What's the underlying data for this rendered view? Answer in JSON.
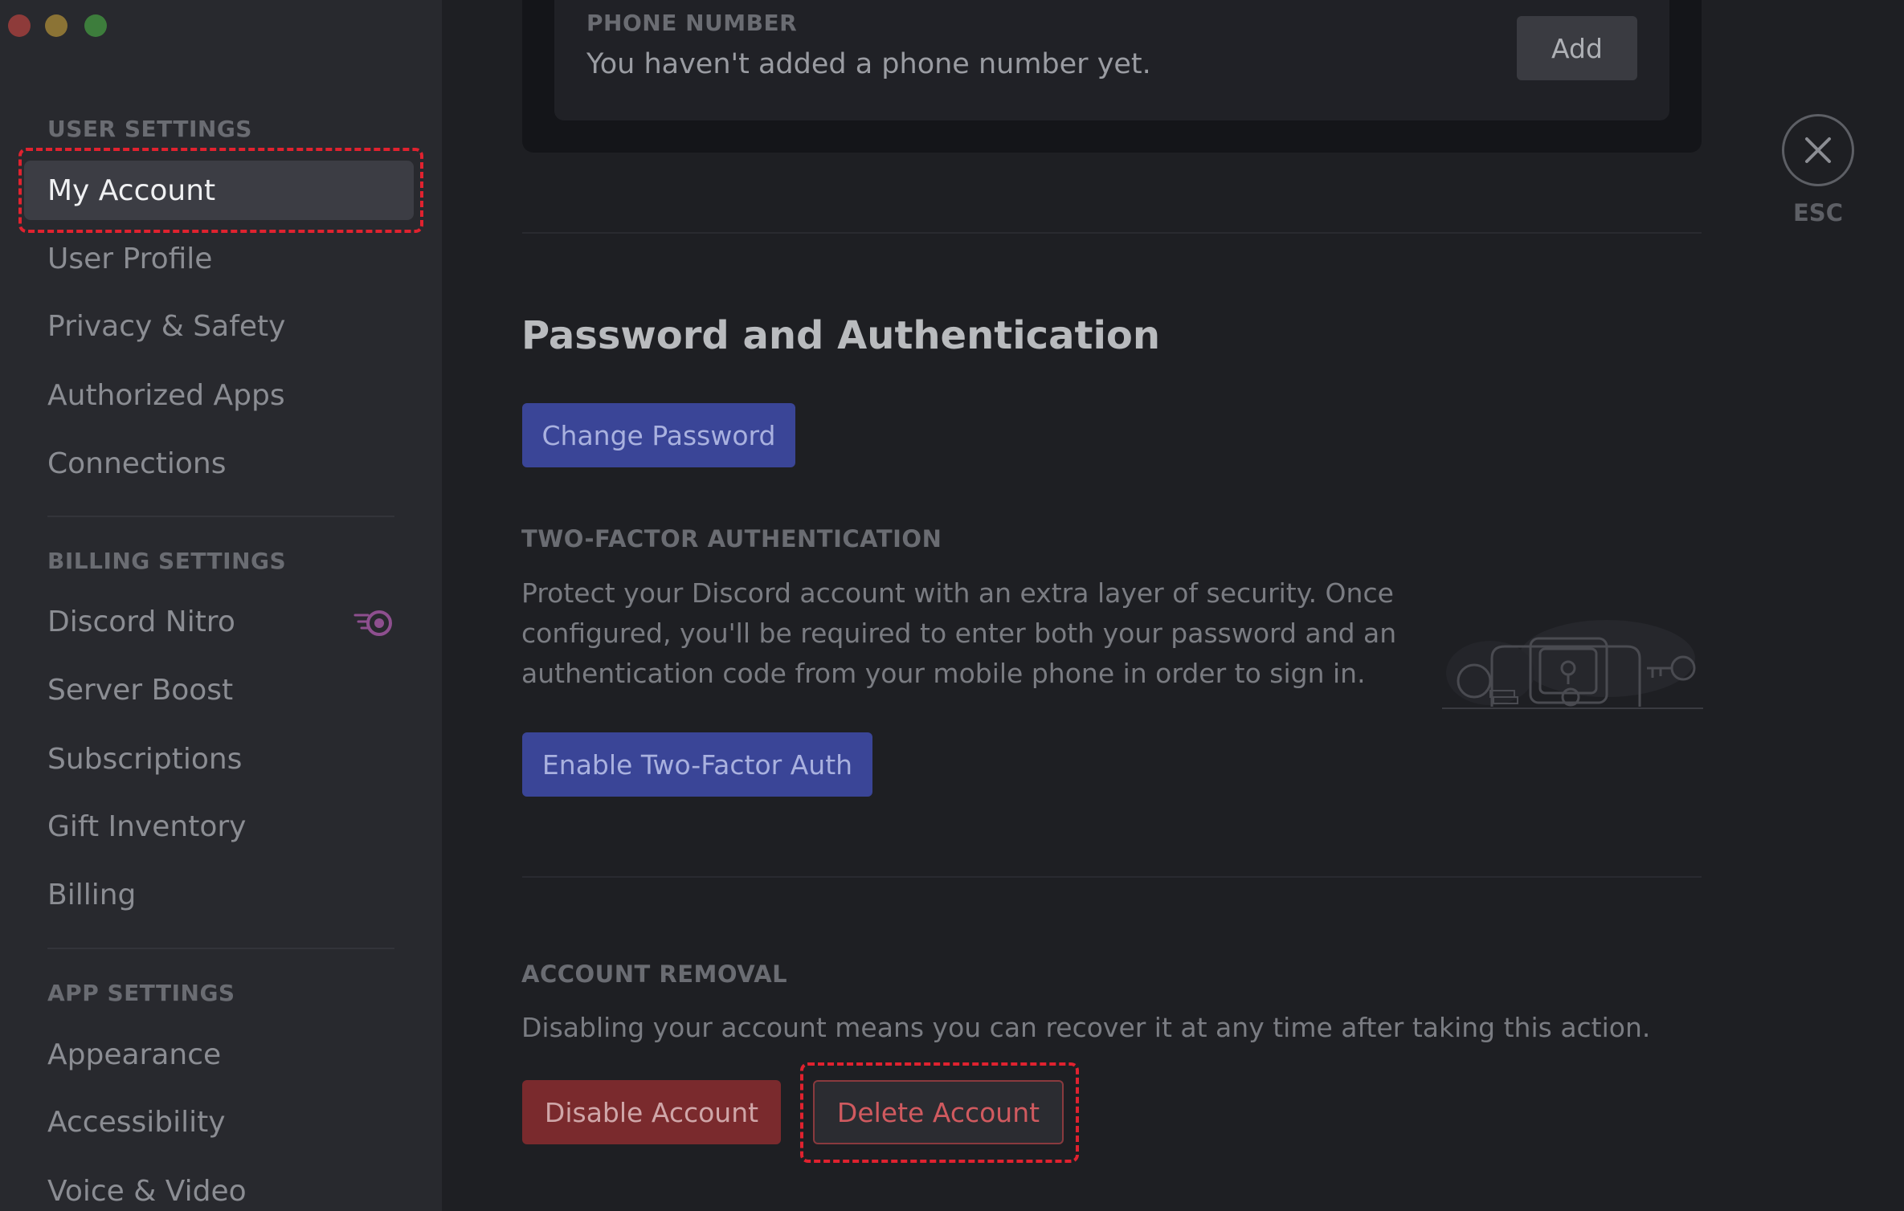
{
  "sidebar": {
    "user_settings_header": "USER SETTINGS",
    "user_items": [
      "My Account",
      "User Profile",
      "Privacy & Safety",
      "Authorized Apps",
      "Connections"
    ],
    "billing_settings_header": "BILLING SETTINGS",
    "billing_items": [
      "Discord Nitro",
      "Server Boost",
      "Subscriptions",
      "Gift Inventory",
      "Billing"
    ],
    "app_settings_header": "APP SETTINGS",
    "app_items": [
      "Appearance",
      "Accessibility",
      "Voice & Video"
    ],
    "active_item": "My Account"
  },
  "phone": {
    "label": "PHONE NUMBER",
    "text": "You haven't added a phone number yet.",
    "add_label": "Add"
  },
  "password_auth": {
    "title": "Password and Authentication",
    "change_password_label": "Change Password",
    "two_factor_label": "TWO-FACTOR AUTHENTICATION",
    "two_factor_desc_lines": [
      "Protect your Discord account with an extra layer of security. Once",
      "configured, you'll be required to enter both your password and an",
      "authentication code from your mobile phone in order to sign in."
    ],
    "enable_2fa_label": "Enable Two-Factor Auth"
  },
  "account_removal": {
    "label": "ACCOUNT REMOVAL",
    "desc": "Disabling your account means you can recover it at any time after taking this action.",
    "disable_label": "Disable Account",
    "delete_label": "Delete Account"
  },
  "close": {
    "esc_label": "ESC"
  },
  "colors": {
    "accent_blue": "#3a4597",
    "danger_red": "#7a2a2d",
    "annotation_red": "#e0222f"
  }
}
